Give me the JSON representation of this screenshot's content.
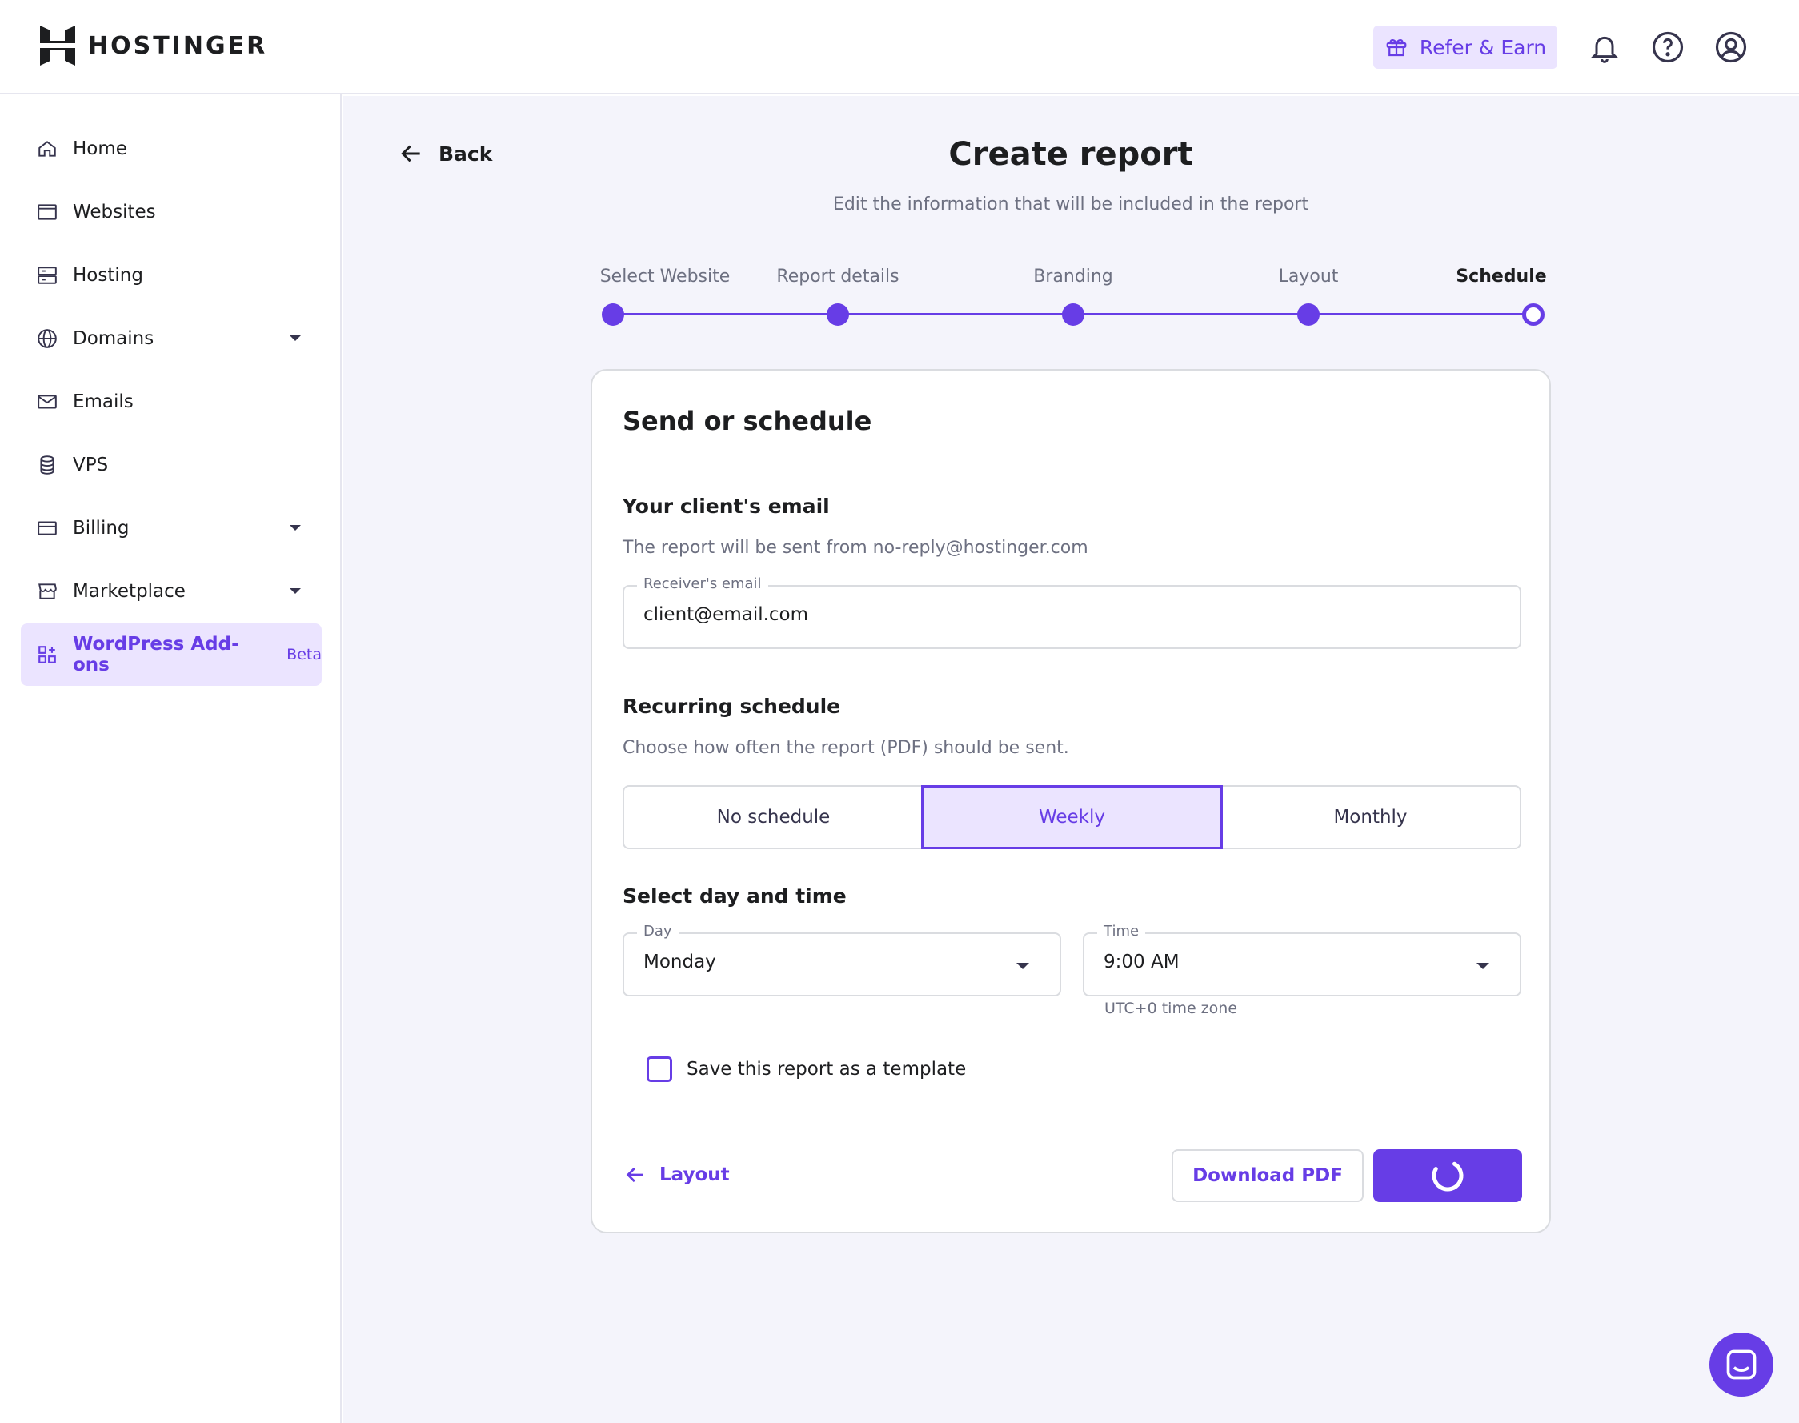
{
  "header": {
    "brand": "HOSTINGER",
    "refer_label": "Refer & Earn"
  },
  "sidebar": {
    "items": [
      {
        "label": "Home",
        "icon": "home-icon"
      },
      {
        "label": "Websites",
        "icon": "browser-icon"
      },
      {
        "label": "Hosting",
        "icon": "server-icon"
      },
      {
        "label": "Domains",
        "icon": "globe-icon"
      },
      {
        "label": "Emails",
        "icon": "mail-icon"
      },
      {
        "label": "VPS",
        "icon": "database-icon"
      },
      {
        "label": "Billing",
        "icon": "credit-card-icon"
      },
      {
        "label": "Marketplace",
        "icon": "store-icon"
      },
      {
        "label": "WordPress Add-ons",
        "icon": "addons-grid-icon",
        "badge": "Beta"
      }
    ]
  },
  "page": {
    "back_label": "Back",
    "title": "Create report",
    "subtitle": "Edit the information that will be included in the report"
  },
  "stepper": {
    "steps": [
      "Select Website",
      "Report details",
      "Branding",
      "Layout",
      "Schedule"
    ],
    "current": "Schedule"
  },
  "card": {
    "title": "Send or schedule",
    "email_section": {
      "title": "Your client's email",
      "desc": "The report will be sent from no-reply@hostinger.com",
      "field_label": "Receiver's email",
      "field_value": "client@email.com"
    },
    "schedule_section": {
      "title": "Recurring schedule",
      "desc": "Choose how often the report (PDF) should be sent.",
      "options": [
        "No schedule",
        "Weekly",
        "Monthly"
      ],
      "selected": "Weekly"
    },
    "daytime_section": {
      "title": "Select day and time",
      "day_label": "Day",
      "day_value": "Monday",
      "time_label": "Time",
      "time_value": "9:00 AM",
      "timezone_hint": "UTC+0 time zone"
    },
    "template_checkbox_label": "Save this report as a template",
    "template_checked": false,
    "prev_step_label": "Layout",
    "download_label": "Download PDF"
  },
  "colors": {
    "accent": "#673de6",
    "accent_light": "#ebe4ff",
    "background": "#f4f4fb"
  }
}
